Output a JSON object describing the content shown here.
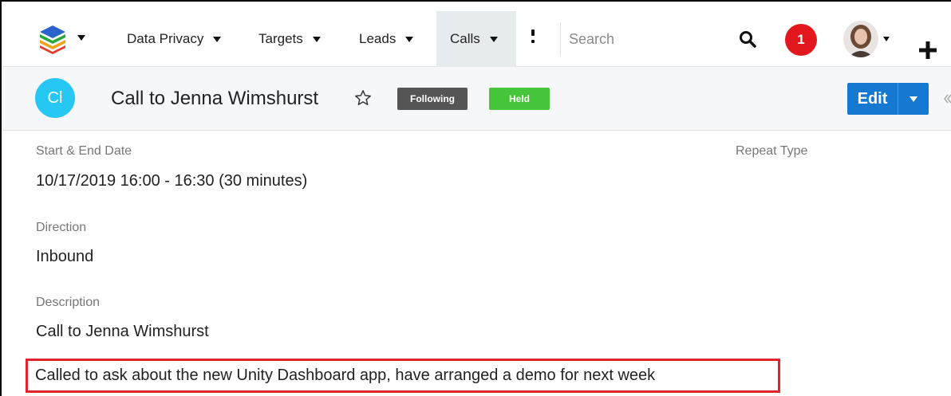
{
  "nav": {
    "items": [
      {
        "label": "Data Privacy"
      },
      {
        "label": "Targets"
      },
      {
        "label": "Leads"
      },
      {
        "label": "Calls",
        "active": true
      }
    ],
    "search_placeholder": "Search",
    "notification_count": "1"
  },
  "record": {
    "avatar_initials": "Cl",
    "title": "Call to Jenna Wimshurst",
    "following_badge": "Following",
    "status_badge": "Held",
    "edit_label": "Edit"
  },
  "fields": {
    "start_end_label": "Start & End Date",
    "start_end_value": "10/17/2019 16:00 - 16:30 (30 minutes)",
    "repeat_type_label": "Repeat Type",
    "direction_label": "Direction",
    "direction_value": "Inbound",
    "description_label": "Description",
    "description_line1": "Call to Jenna Wimshurst",
    "description_line2": "Called to ask about the new Unity Dashboard app, have arranged a demo for next week"
  },
  "colors": {
    "accent": "#1679d1",
    "record_avatar": "#27c7f3",
    "held_badge": "#46c43a",
    "following_badge": "#555555",
    "notification": "#e3181f",
    "highlight_border": "#e0232c"
  }
}
